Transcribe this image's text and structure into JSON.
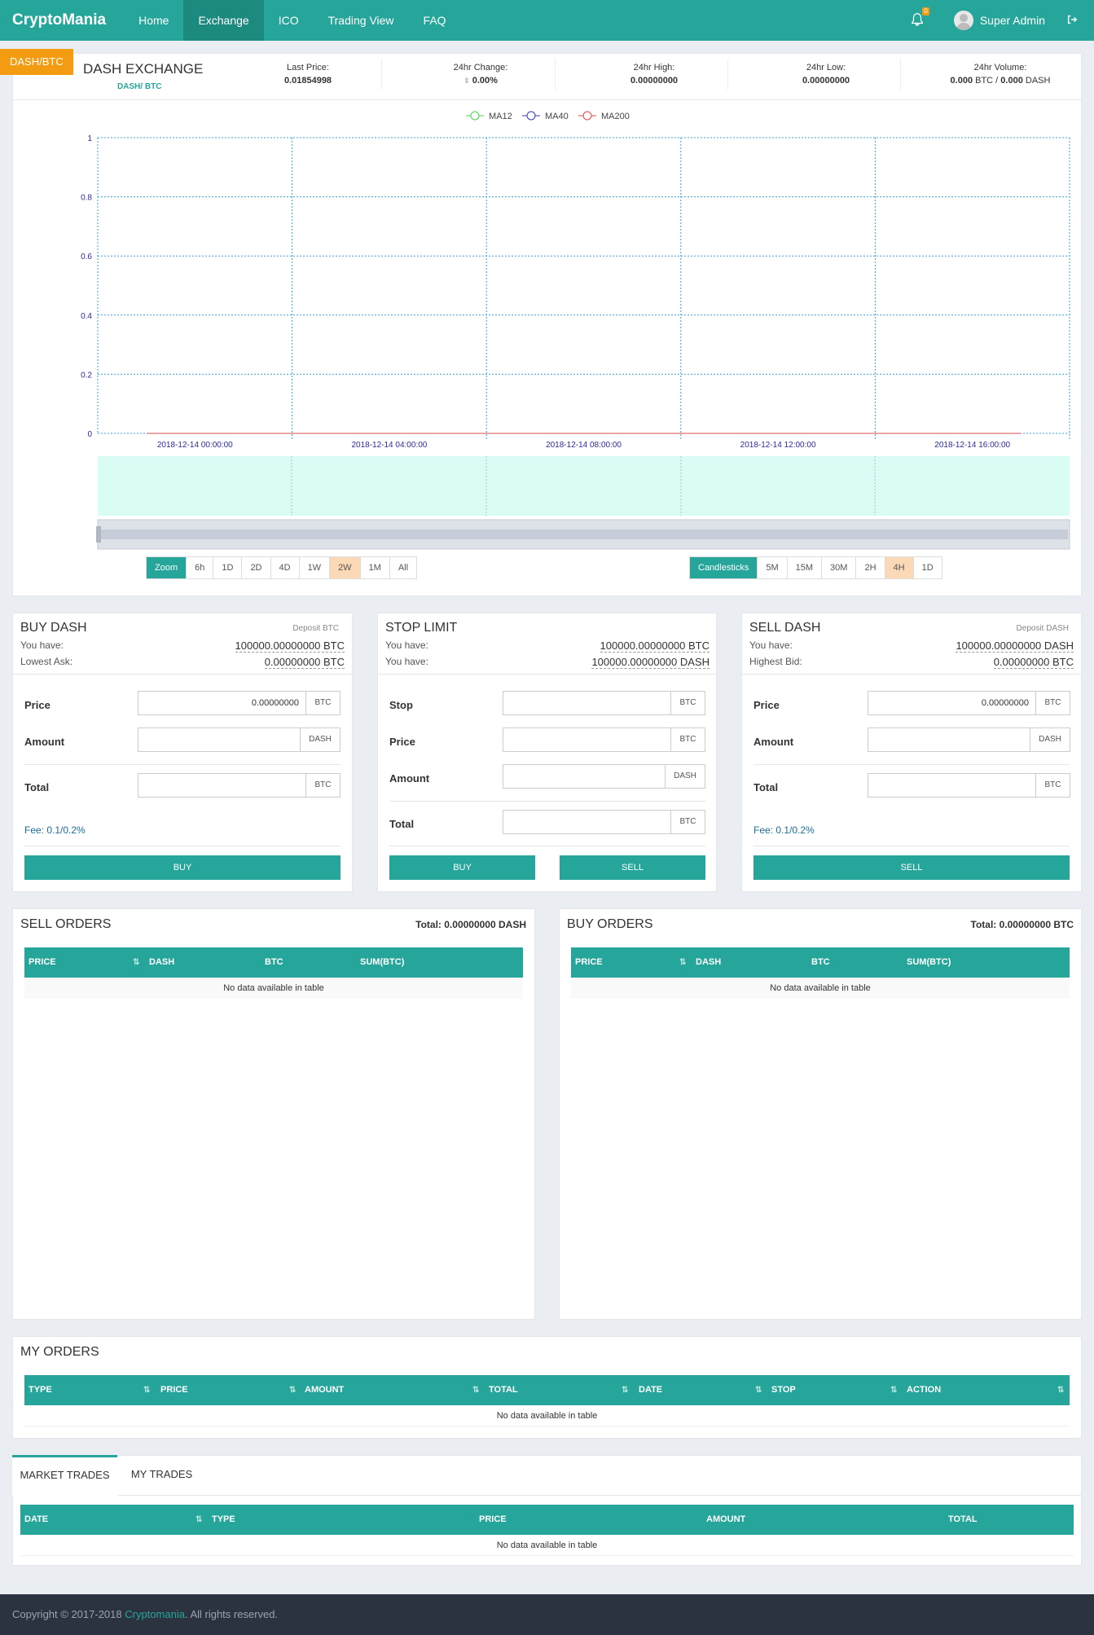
{
  "nav": {
    "brand": "CryptoMania",
    "links": [
      "Home",
      "Exchange",
      "ICO",
      "Trading View",
      "FAQ"
    ],
    "active": "Exchange",
    "notif_count": "0",
    "user": "Super Admin"
  },
  "market": {
    "pair_badge": "DASH/BTC",
    "title": "DASH EXCHANGE",
    "subtitle": "DASH/ BTC",
    "last_price_label": "Last Price:",
    "last_price": "0.01854998",
    "change_label": "24hr Change:",
    "change": "0.00%",
    "high_label": "24hr High:",
    "high": "0.00000000",
    "low_label": "24hr Low:",
    "low": "0.00000000",
    "volume_label": "24hr Volume:",
    "volume_btc": "0.000",
    "volume_btc_unit": " BTC / ",
    "volume_dash": "0.000",
    "volume_dash_unit": " DASH"
  },
  "chart_data": {
    "type": "line",
    "legend": [
      "MA12",
      "MA40",
      "MA200"
    ],
    "legend_colors": [
      "#4cd34c",
      "#3a3ab8",
      "#d94a4a"
    ],
    "y_ticks": [
      "0",
      "0.2",
      "0.4",
      "0.6",
      "0.8",
      "1"
    ],
    "ylim": [
      0,
      1
    ],
    "x_ticks": [
      "2018-12-14 00:00:00",
      "2018-12-14 04:00:00",
      "2018-12-14 08:00:00",
      "2018-12-14 12:00:00",
      "2018-12-14 16:00:00"
    ],
    "series": [
      {
        "name": "MA12",
        "values": [
          0,
          0,
          0,
          0,
          0
        ]
      },
      {
        "name": "MA40",
        "values": [
          0,
          0,
          0,
          0,
          0
        ]
      },
      {
        "name": "MA200",
        "values": [
          0,
          0,
          0,
          0,
          0
        ]
      }
    ]
  },
  "zoom": {
    "label": "Zoom",
    "options": [
      "6h",
      "1D",
      "2D",
      "4D",
      "1W",
      "2W",
      "1M",
      "All"
    ],
    "selected": "2W"
  },
  "candles": {
    "label": "Candlesticks",
    "options": [
      "5M",
      "15M",
      "30M",
      "2H",
      "4H",
      "1D"
    ],
    "selected": "4H"
  },
  "buy": {
    "title": "BUY DASH",
    "deposit": "Deposit BTC",
    "have_label": "You have:",
    "have": "100000.00000000 BTC",
    "ask_label": "Lowest Ask:",
    "ask": "0.00000000 BTC",
    "price_label": "Price",
    "price_value": "0.00000000",
    "price_unit": "BTC",
    "amount_label": "Amount",
    "amount_unit": "DASH",
    "total_label": "Total",
    "total_unit": "BTC",
    "fee": "Fee: 0.1/0.2%",
    "button": "BUY"
  },
  "stop": {
    "title": "STOP LIMIT",
    "have_label": "You have:",
    "have_btc": "100000.00000000 BTC",
    "have_label2": "You have:",
    "have_dash": "100000.00000000 DASH",
    "stop_label": "Stop",
    "stop_unit": "BTC",
    "price_label": "Price",
    "price_unit": "BTC",
    "amount_label": "Amount",
    "amount_unit": "DASH",
    "total_label": "Total",
    "total_unit": "BTC",
    "buy_button": "BUY",
    "sell_button": "SELL"
  },
  "sell": {
    "title": "SELL DASH",
    "deposit": "Deposit DASH",
    "have_label": "You have:",
    "have": "100000.00000000 DASH",
    "bid_label": "Highest Bid:",
    "bid": "0.00000000 BTC",
    "price_label": "Price",
    "price_value": "0.00000000",
    "price_unit": "BTC",
    "amount_label": "Amount",
    "amount_unit": "DASH",
    "total_label": "Total",
    "total_unit": "BTC",
    "fee": "Fee: 0.1/0.2%",
    "button": "SELL"
  },
  "sell_orders": {
    "title": "SELL ORDERS",
    "total": "Total: 0.00000000 DASH",
    "cols": [
      "PRICE",
      "DASH",
      "BTC",
      "SUM(BTC)"
    ],
    "empty": "No data available in table"
  },
  "buy_orders": {
    "title": "BUY ORDERS",
    "total": "Total: 0.00000000 BTC",
    "cols": [
      "PRICE",
      "DASH",
      "BTC",
      "SUM(BTC)"
    ],
    "empty": "No data available in table"
  },
  "my_orders": {
    "title": "MY ORDERS",
    "cols": [
      "TYPE",
      "PRICE",
      "AMOUNT",
      "TOTAL",
      "DATE",
      "STOP",
      "ACTION"
    ],
    "empty": "No data available in table"
  },
  "trades": {
    "tabs": [
      "MARKET TRADES",
      "MY TRADES"
    ],
    "cols": [
      "DATE",
      "TYPE",
      "PRICE",
      "AMOUNT",
      "TOTAL"
    ],
    "empty": "No data available in table"
  },
  "footer": {
    "text": "Copyright © 2017-2018 ",
    "brand": "Cryptomania",
    "suffix": ". All rights reserved."
  },
  "colors": {
    "accent": "#26a69a",
    "orange": "#f39c12",
    "highlight": "#fcd9b6"
  }
}
